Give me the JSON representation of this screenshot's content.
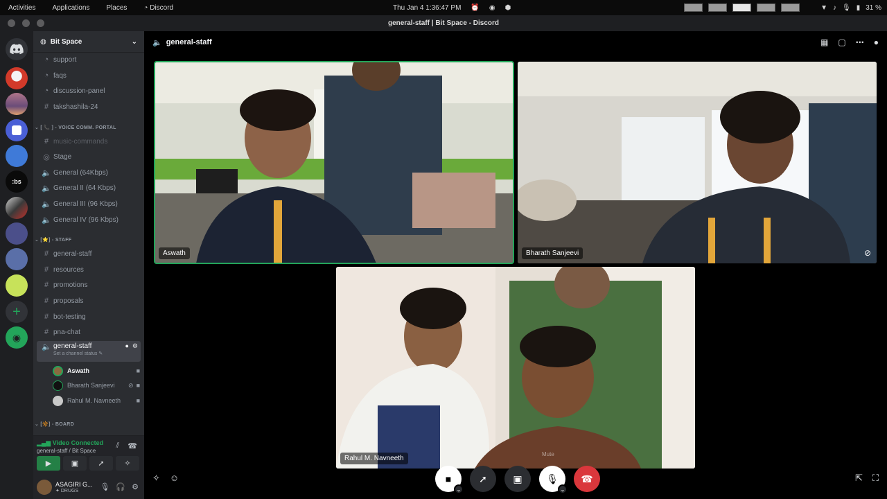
{
  "gnome": {
    "activities": "Activities",
    "applications": "Applications",
    "places": "Places",
    "app": "Discord",
    "clock": "Thu Jan 4  1:36:47 PM",
    "battery": "31 %"
  },
  "window": {
    "title": "general-staff | Bit Space - Discord"
  },
  "server": {
    "name": "Bit Space",
    "channels": [
      {
        "label": "support",
        "type": "forum"
      },
      {
        "label": "faqs",
        "type": "forum"
      },
      {
        "label": "discussion-panel",
        "type": "forum"
      },
      {
        "label": "takshashila-24",
        "type": "text"
      }
    ],
    "voice_category": "[ 📞 ] - VOICE COMM. PORTAL",
    "voice_channels": [
      {
        "label": "music-commands",
        "type": "text",
        "muted": true
      },
      {
        "label": "Stage",
        "type": "stage"
      },
      {
        "label": "General (64Kbps)",
        "type": "voice"
      },
      {
        "label": "General II (64 Kbps)",
        "type": "voice"
      },
      {
        "label": "General III (96 Kbps)",
        "type": "voice"
      },
      {
        "label": "General IV (96 Kbps)",
        "type": "voice"
      }
    ],
    "staff_category": "[⭐] - STAFF",
    "staff_channels": [
      {
        "label": "general-staff",
        "type": "voice"
      },
      {
        "label": "resources",
        "type": "text"
      },
      {
        "label": "promotions",
        "type": "text"
      },
      {
        "label": "proposals",
        "type": "text"
      },
      {
        "label": "bot-testing",
        "type": "text"
      },
      {
        "label": "pna-chat",
        "type": "text"
      }
    ],
    "selected_channel": {
      "label": "general-staff",
      "status_placeholder": "Set a channel status"
    },
    "voice_users": [
      {
        "name": "Aswath",
        "bold": true
      },
      {
        "name": "Bharath Sanjeevi",
        "bold": false
      },
      {
        "name": "Rahul M. Navneeth",
        "bold": false
      }
    ],
    "board_category": "[🔆] - BOARD"
  },
  "rtc": {
    "status": "Video Connected",
    "location": "general-staff / Bit Space"
  },
  "user": {
    "name": "ASAGIRI G...",
    "status": "DRUGS"
  },
  "stage": {
    "channel": "general-staff",
    "tiles": [
      {
        "name": "Aswath",
        "speaking": true
      },
      {
        "name": "Bharath Sanjeevi",
        "muted": true
      },
      {
        "name": "Rahul M. Navneeth",
        "overlay": "Mute"
      }
    ]
  },
  "colors": {
    "online": "#23a55a",
    "danger": "#da373c",
    "sidebar": "#2b2d31",
    "guild_rail": "#1e1f22"
  }
}
